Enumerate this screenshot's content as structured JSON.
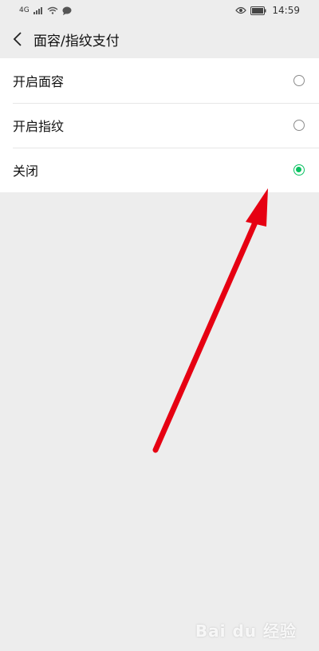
{
  "status_bar": {
    "network": "4G",
    "time": "14:59"
  },
  "header": {
    "title": "面容/指纹支付"
  },
  "options": [
    {
      "label": "开启面容",
      "selected": false
    },
    {
      "label": "开启指纹",
      "selected": false
    },
    {
      "label": "关闭",
      "selected": true
    }
  ],
  "colors": {
    "accent": "#07c160",
    "annotation_arrow": "#e60012"
  },
  "watermark": "Bai du 经验"
}
